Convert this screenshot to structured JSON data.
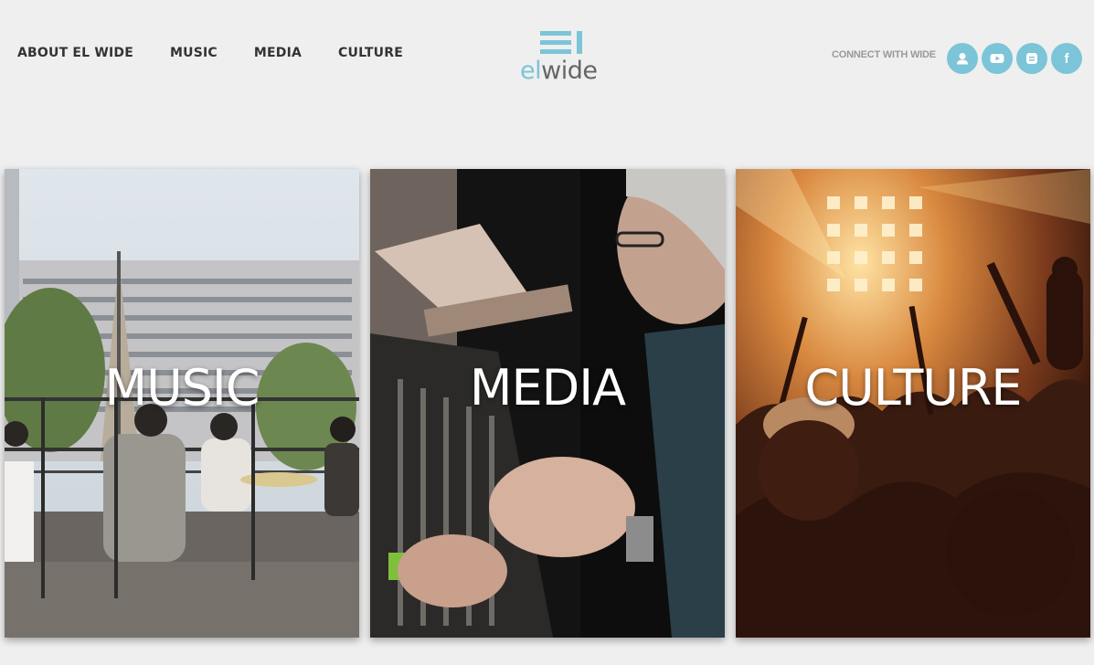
{
  "nav": {
    "items": [
      {
        "label": "ABOUT EL WIDE"
      },
      {
        "label": "MUSIC"
      },
      {
        "label": "MEDIA"
      },
      {
        "label": "CULTURE"
      }
    ]
  },
  "logo": {
    "el": "el",
    "wide": "wide",
    "accent": "#7cc4d8"
  },
  "connect": {
    "label": "CONNECT WITH WIDE",
    "icons": [
      "user-icon",
      "youtube-icon",
      "blog-icon",
      "facebook-icon"
    ],
    "facebook_glyph": "f"
  },
  "panels": [
    {
      "title": "MUSIC",
      "scene": "rooftop band performance"
    },
    {
      "title": "MEDIA",
      "scene": "man at mixing console"
    },
    {
      "title": "CULTURE",
      "scene": "concert crowd with stage lights"
    }
  ]
}
